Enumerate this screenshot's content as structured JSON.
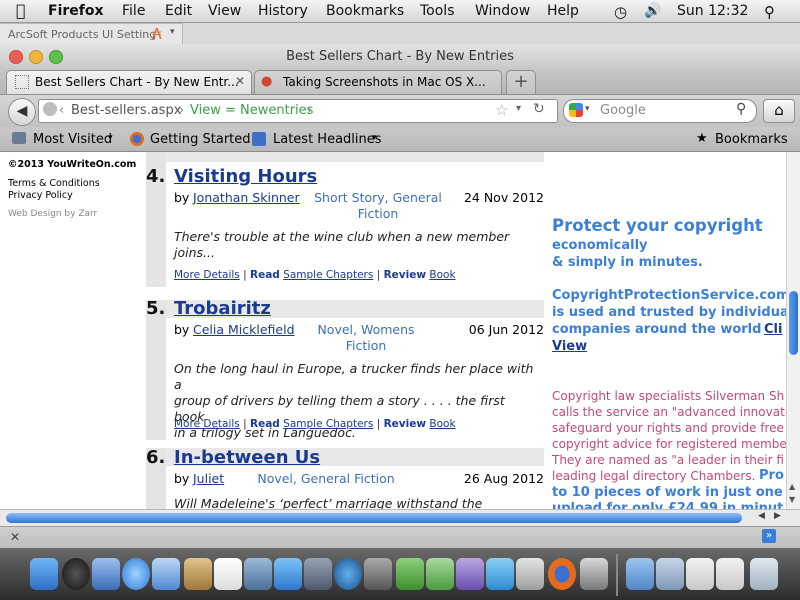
{
  "menubar": {
    "app": "Firefox",
    "items": [
      "File",
      "Edit",
      "View",
      "History",
      "Bookmarks",
      "Tools",
      "Window",
      "Help"
    ],
    "clock": "Sun 12:32"
  },
  "toolbar_extra": {
    "arcsoft": "ArcSoft Products UI Setting"
  },
  "window": {
    "title": "Best Sellers Chart - By New Entries"
  },
  "tabs": [
    {
      "label": "Best Sellers Chart - By New Entr..."
    },
    {
      "label": "Taking Screenshots in Mac OS X..."
    }
  ],
  "nav": {
    "url_path": "Best-sellers.aspx",
    "url_crumb": "View = Newentries",
    "search_placeholder": "Google"
  },
  "bookmarks": {
    "items": [
      "Most Visited",
      "Getting Started",
      "Latest Headlines"
    ],
    "right": "Bookmarks"
  },
  "sidebar": {
    "copyright": "©2013 YouWriteOn.com",
    "terms": "Terms & Conditions",
    "privacy": "Privacy Policy",
    "design": "Web Design by Zarr"
  },
  "entries": [
    {
      "num": "4.",
      "title": "Visiting Hours",
      "by": "by",
      "author": "Jonathan Skinner",
      "genre1": "Short Story, General",
      "genre2": "Fiction",
      "date": "24 Nov 2012",
      "blurb1": "There's trouble at the wine club when a new member",
      "blurb2": "joins...",
      "blurb3": ""
    },
    {
      "num": "5.",
      "title": "Trobairitz",
      "by": "by",
      "author": "Celia Micklefield",
      "genre1": "Novel, Womens",
      "genre2": "Fiction",
      "date": "06 Jun 2012",
      "blurb1": "On the long haul in Europe, a trucker finds her place with a",
      "blurb2": "group of drivers by telling them a story . . . . the first book",
      "blurb3": "in a trilogy set in Languedoc."
    },
    {
      "num": "6.",
      "title": "In-between Us",
      "by": "by",
      "author": "Juliet",
      "genre1": "Novel, General Fiction",
      "genre2": "",
      "date": "26 Aug 2012",
      "blurb1": "Will Madeleine's ‘perfect’ marriage withstand the",
      "blurb2": "",
      "blurb3": ""
    }
  ],
  "entry_links": {
    "more": "More Details",
    "sep": "|",
    "read": "Read",
    "read_rest": "Sample Chapters",
    "review": "Review",
    "review_rest": "Book"
  },
  "ad": {
    "headline": "Protect your copyright",
    "line2": "economically",
    "line3": "& simply in minutes.",
    "site": "CopyrightProtectionService.com",
    "site2": "is used and trusted by individual",
    "site3": "companies around the world",
    "click": "Cli",
    "view": "View",
    "body": [
      "Copyright law specialists Silverman Sh",
      "calls the service an \"advanced innovati",
      "safeguard your rights and provide free",
      "copyright advice for registered membe",
      "They are named as \"a leader in their fi",
      "leading legal directory Chambers."
    ],
    "promo1": "Pro",
    "promo2": "to 10 pieces of work in just one",
    "promo3": "upload for only £24.99 in minut"
  },
  "colors": {
    "link": "#1a3b8f",
    "genre": "#3f6fb6",
    "ad_blue": "#3b7fd6",
    "ad_pink": "#c04a7a"
  }
}
